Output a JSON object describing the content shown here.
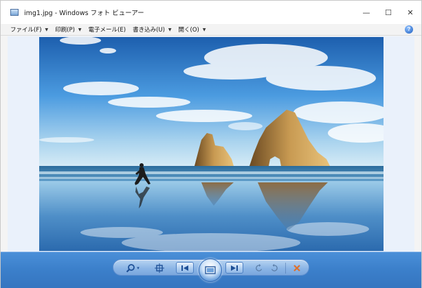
{
  "window": {
    "title": "img1.jpg - Windows フォト ビューアー",
    "controls": {
      "minimize": "—",
      "maximize": "☐",
      "close": "✕"
    }
  },
  "menubar": {
    "items": [
      {
        "label": "ファイル(F)",
        "has_dropdown": true
      },
      {
        "label": "印刷(P)",
        "has_dropdown": true
      },
      {
        "label": "電子メール(E)",
        "has_dropdown": false
      },
      {
        "label": "書き込み(U)",
        "has_dropdown": true
      },
      {
        "label": "開く(O)",
        "has_dropdown": true
      }
    ],
    "dropdown_glyph": "▼",
    "help_glyph": "?"
  },
  "photo": {
    "subject": "beach-sea-stacks-runner"
  },
  "toolbar": {
    "icons": [
      "zoom-icon",
      "actual-size-icon",
      "previous-icon",
      "slideshow-icon",
      "next-icon",
      "rotate-counterclockwise-icon",
      "rotate-clockwise-icon",
      "delete-icon"
    ],
    "zoom_dropdown_glyph": "▾"
  },
  "colors": {
    "bottom_bar": "#3b7fca",
    "view_background": "#eaf1fb",
    "delete_accent": "#e0702a"
  }
}
